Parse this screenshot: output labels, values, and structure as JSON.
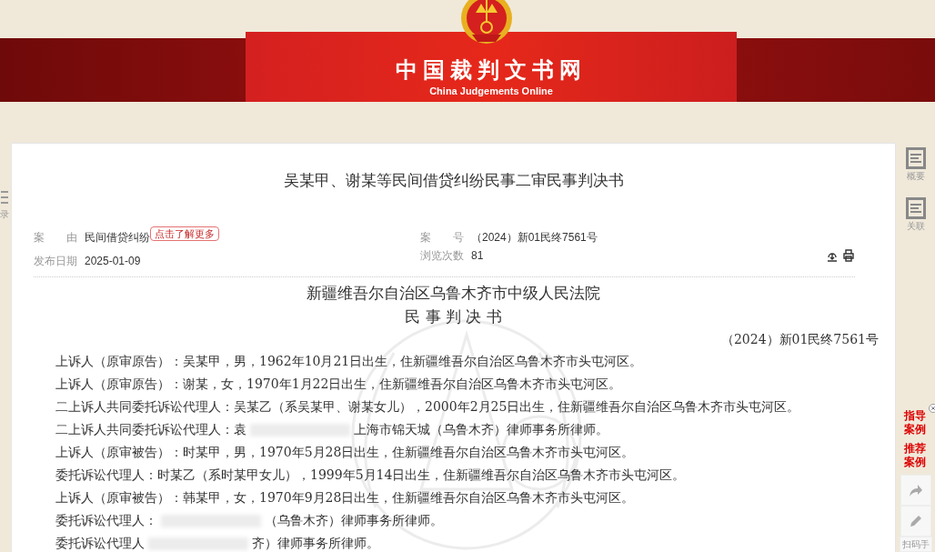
{
  "banner": {
    "title": "中国裁判文书网",
    "subtitle": "China Judgements Online"
  },
  "left_tab": {
    "label": "录"
  },
  "document": {
    "title": "吴某甲、谢某等民间借贷纠纷民事二审民事判决书",
    "meta": [
      {
        "label": "案　　由",
        "value": "民间借贷纠纷",
        "badge": "点击了解更多"
      },
      {
        "label": "案　　号",
        "value": "（2024）新01民终7561号"
      },
      {
        "label": "发布日期",
        "value": "2025-01-09"
      },
      {
        "label": "浏览次数",
        "value": "81"
      }
    ],
    "court": "新疆维吾尔自治区乌鲁木齐市中级人民法院",
    "doc_type": "民 事 判 决 书",
    "case_number": "（2024）新01民终7561号",
    "paragraphs": [
      {
        "segments": [
          "上诉人（原审原告）：吴某甲，男，1962年10月21日出生，住新疆维吾尔自治区乌鲁木齐市头屯河区。"
        ]
      },
      {
        "segments": [
          "上诉人（原审原告）：谢某，女，1970年1月22日出生，住新疆维吾尔自治区乌鲁木齐市头屯河区。"
        ]
      },
      {
        "segments": [
          "二上诉人共同委托诉讼代理人：吴某乙（系吴某甲、谢某女儿），2000年2月25日出生，住新疆维吾尔自治区乌鲁木齐市头屯河区。"
        ]
      },
      {
        "segments": [
          "二上诉人共同委托诉讼代理人：袁",
          "上海市锦天城（乌鲁木齐）律师事务所律师。"
        ]
      },
      {
        "segments": [
          "上诉人（原审被告）：时某甲，男，1970年5月28日出生，住新疆维吾尔自治区乌鲁木齐市头屯河区。"
        ]
      },
      {
        "segments": [
          "委托诉讼代理人：时某乙（系时某甲女儿），1999年5月14日出生，住新疆维吾尔自治区乌鲁木齐市头屯河区。"
        ]
      },
      {
        "segments": [
          "上诉人（原审被告）：韩某甲，女，1970年9月28日出生，住新疆维吾尔自治区乌鲁木齐市头屯河区。"
        ]
      },
      {
        "segments": [
          "委托诉讼代理人：",
          "（乌鲁木齐）律师事务所律师。"
        ]
      },
      {
        "segments": [
          "委托诉讼代理人",
          "齐）律师事务所律师。"
        ]
      }
    ]
  },
  "side_tools": [
    {
      "label": "概要"
    },
    {
      "label": "关联"
    }
  ],
  "side_links": [
    {
      "label": "指导案例"
    },
    {
      "label": "推荐案例"
    }
  ],
  "scan_label": "扫码手"
}
